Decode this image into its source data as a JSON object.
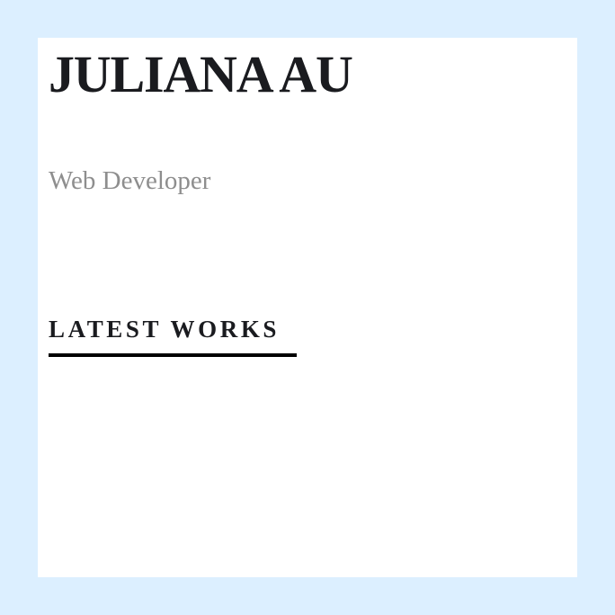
{
  "profile": {
    "name": "JULIANA AU",
    "role": "Web Developer"
  },
  "sections": {
    "latest_works_title": "LATEST WORKS"
  },
  "colors": {
    "page_background": "#dcefff",
    "card_background": "#ffffff",
    "heading_text": "#1a1b1f",
    "muted_text": "#8e8e8e",
    "underline": "#000000"
  }
}
